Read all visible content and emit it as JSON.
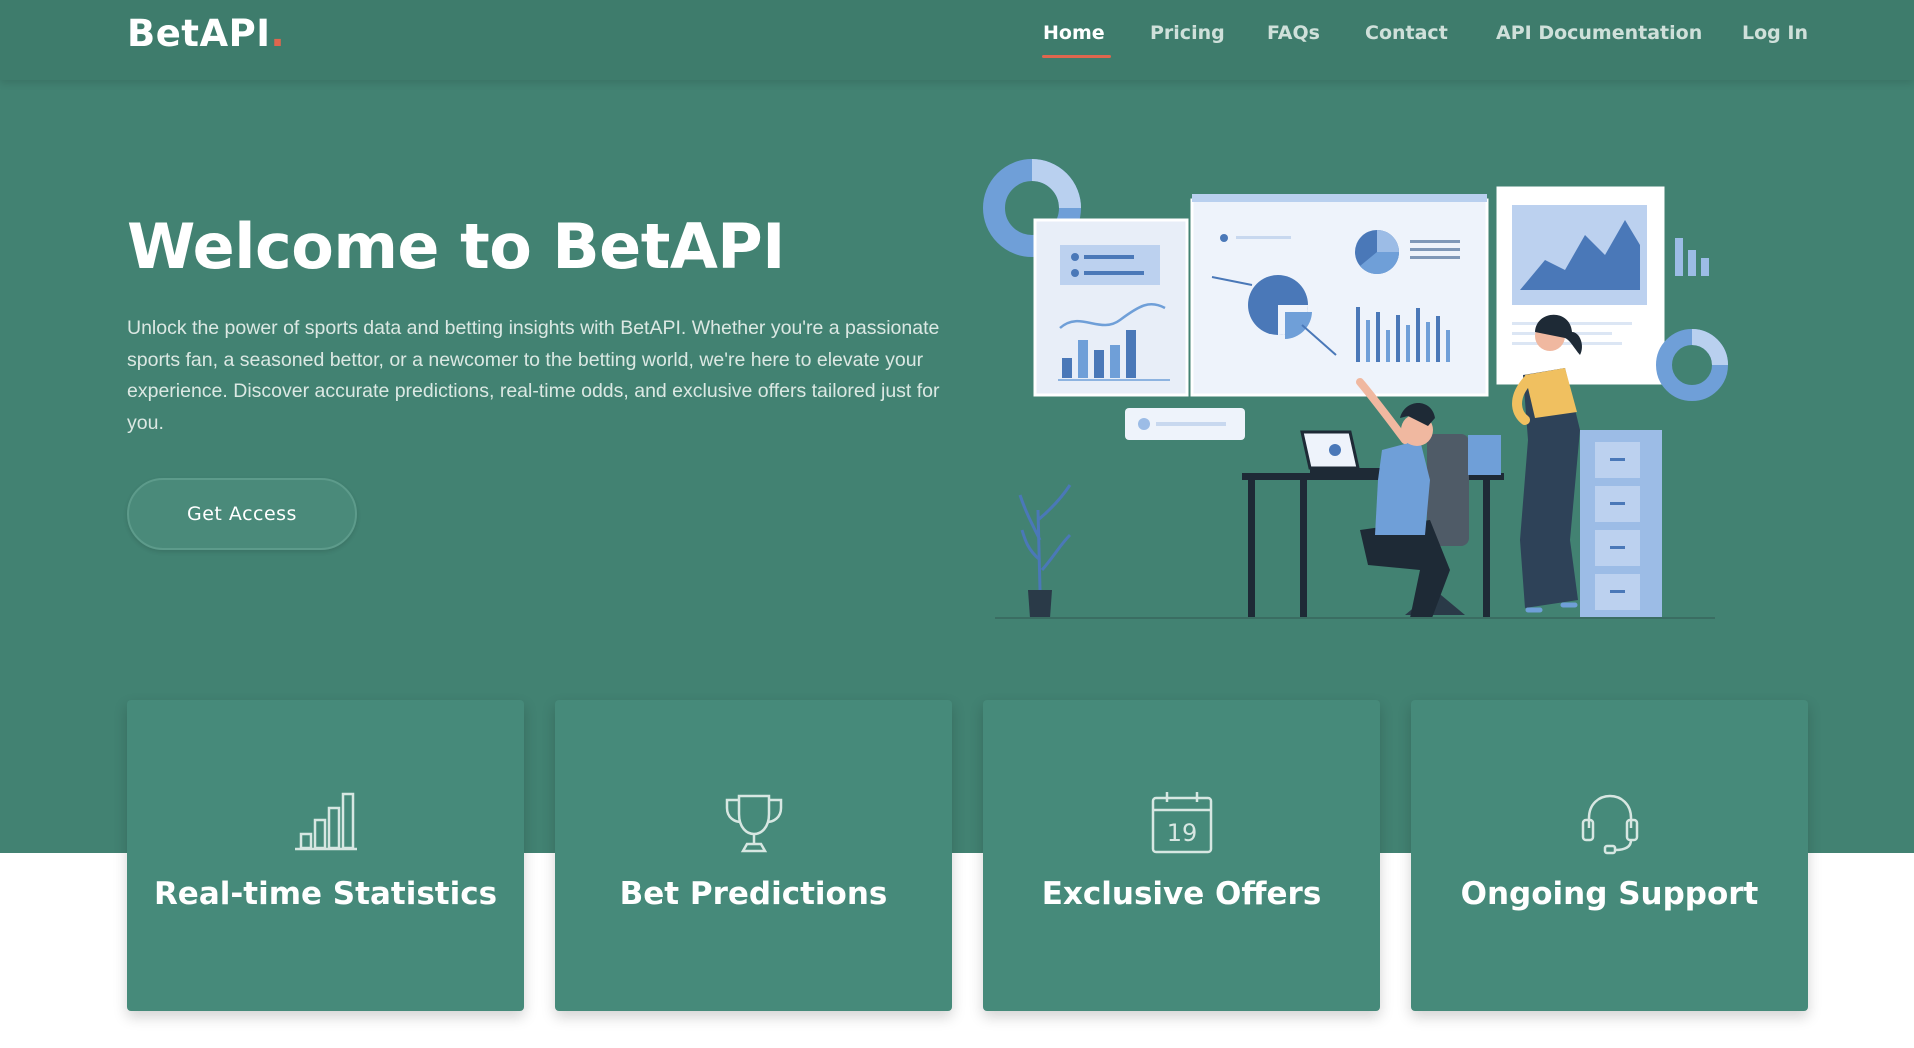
{
  "brand": {
    "name": "BetAPI",
    "dot": "."
  },
  "nav": {
    "items": [
      {
        "label": "Home"
      },
      {
        "label": "Pricing"
      },
      {
        "label": "FAQs"
      },
      {
        "label": "Contact"
      },
      {
        "label": "API Documentation"
      },
      {
        "label": "Log In"
      }
    ],
    "active": "Home"
  },
  "hero": {
    "title": "Welcome to BetAPI",
    "description": "Unlock the power of sports data and betting insights with BetAPI. Whether you're a passionate sports fan, a seasoned bettor, or a newcomer to the betting world, we're here to elevate your experience. Discover accurate predictions, real-time odds, and exclusive offers tailored just for you.",
    "cta_label": "Get Access"
  },
  "features": [
    {
      "title": "Real-time Statistics",
      "icon": "bar-chart-icon"
    },
    {
      "title": "Bet Predictions",
      "icon": "trophy-icon"
    },
    {
      "title": "Exclusive Offers",
      "icon": "calendar-icon",
      "icon_text": "19"
    },
    {
      "title": "Ongoing Support",
      "icon": "headset-icon"
    }
  ],
  "colors": {
    "hero_bg": "#428272",
    "nav_bg": "#3e7c6c",
    "card_bg": "#468a7a",
    "accent": "#e0664e",
    "illustration_blue": "#6f9fd8"
  }
}
